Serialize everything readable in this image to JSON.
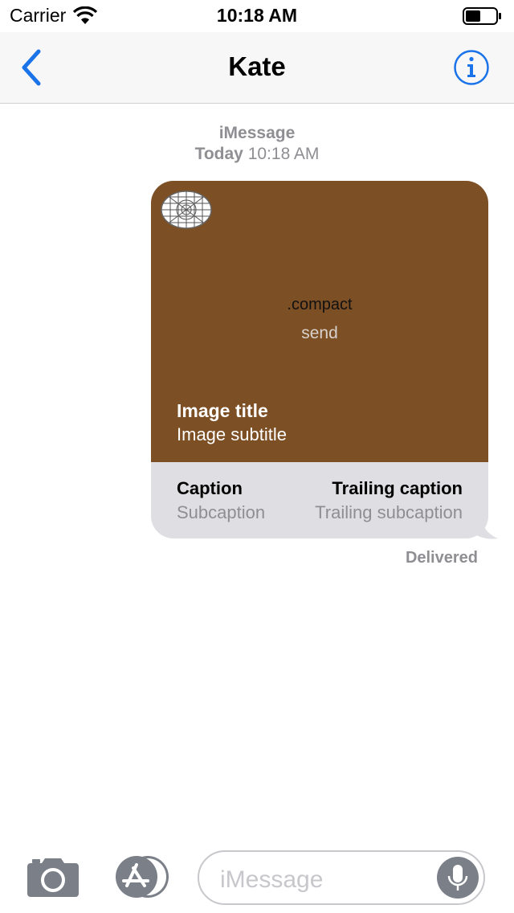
{
  "status_bar": {
    "carrier": "Carrier",
    "time": "10:18 AM"
  },
  "nav": {
    "title": "Kate"
  },
  "thread": {
    "service": "iMessage",
    "day": "Today",
    "time": "10:18 AM"
  },
  "message": {
    "center_label": ".compact",
    "center_sublabel": "send",
    "image_title": "Image title",
    "image_subtitle": "Image subtitle",
    "caption": "Caption",
    "subcaption": "Subcaption",
    "trailing_caption": "Trailing caption",
    "trailing_subcaption": "Trailing subcaption",
    "image_background": "#7d4f25",
    "status": "Delivered"
  },
  "compose": {
    "placeholder": "iMessage"
  },
  "icons": [
    "wifi-icon",
    "battery-icon",
    "back-chevron-icon",
    "info-icon",
    "app-icon",
    "camera-icon",
    "app-store-icon",
    "microphone-icon"
  ],
  "colors": {
    "accent": "#1a73e8",
    "secondary_text": "#8e8e93"
  }
}
